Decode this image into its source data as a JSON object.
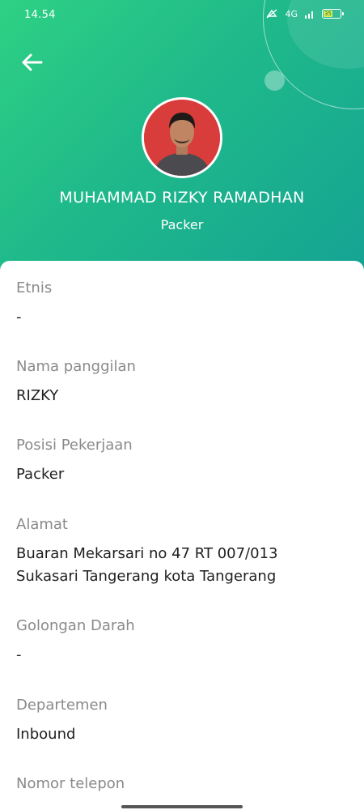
{
  "status_bar": {
    "time": "14.54",
    "network": "4G",
    "battery": "35"
  },
  "header": {
    "back_icon": "arrow-left-icon",
    "name": "MUHAMMAD RIZKY RAMADHAN",
    "role": "Packer"
  },
  "details": [
    {
      "label": "Etnis",
      "value": "-"
    },
    {
      "label": "Nama panggilan",
      "value": "RIZKY"
    },
    {
      "label": "Posisi Pekerjaan",
      "value": "Packer"
    },
    {
      "label": "Alamat",
      "value": "Buaran Mekarsari no 47 RT 007/013 Sukasari Tangerang kota Tangerang"
    },
    {
      "label": "Golongan Darah",
      "value": "-"
    },
    {
      "label": "Departemen",
      "value": "Inbound"
    },
    {
      "label": "Nomor telepon",
      "value": ""
    }
  ],
  "colors": {
    "header_gradient_start": "#2ed184",
    "header_gradient_end": "#15a394",
    "label": "#8a8a8a",
    "value": "#1f1f1f"
  }
}
